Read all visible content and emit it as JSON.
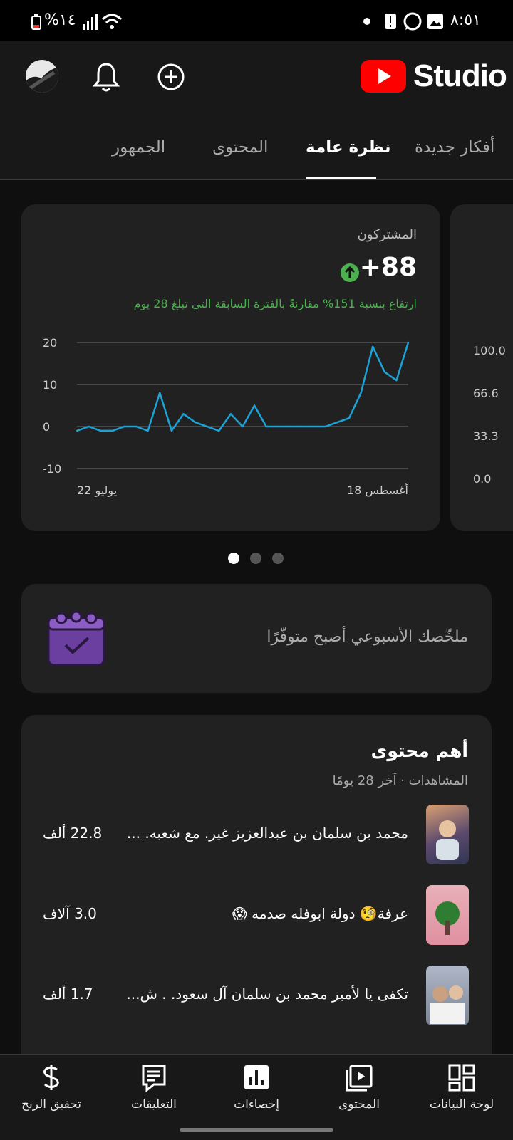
{
  "status_bar": {
    "time": "٨:٥١",
    "battery": "%١٤"
  },
  "header": {
    "brand": "Studio"
  },
  "tabs": [
    {
      "label": "أفكار جديدة"
    },
    {
      "label": "نظرة عامة"
    },
    {
      "label": "المحتوى"
    },
    {
      "label": "الجمهور"
    }
  ],
  "subscribers_card": {
    "title": "المشتركون",
    "value": "+88",
    "change_text": "ارتفاع بنسبة 151% مقارنةً بالفترة السابقة التي تبلغ 28 يوم",
    "accent_color": "#4caf50",
    "line_color": "#1aa3d8"
  },
  "chart_data": [
    {
      "type": "line",
      "title": "المشتركون",
      "xlabel": "",
      "ylabel": "",
      "x_tick_labels": [
        "22 يوليو",
        "18 أغسطس"
      ],
      "y_ticks": [
        20,
        10,
        0,
        -10
      ],
      "ylim": [
        -10,
        20
      ],
      "grid": true,
      "series": [
        {
          "values": [
            -1,
            0,
            -1,
            -1,
            0,
            0,
            -1,
            8,
            -1,
            3,
            1,
            0,
            -1,
            3,
            0,
            5,
            0,
            0,
            0,
            0,
            0,
            0,
            1,
            2,
            8,
            19,
            13,
            11,
            20
          ]
        }
      ]
    }
  ],
  "peek_card": {
    "y_ticks": [
      "100.0",
      "66.6",
      "33.3",
      "0.0"
    ]
  },
  "pager": {
    "active_index": 0,
    "count": 3
  },
  "weekly_summary": {
    "text": "ملخّصك الأسبوعي أصبح متوفّرًا"
  },
  "top_content": {
    "title": "أهم محتوى",
    "subtitle": "المشاهدات · آخر 28 يومًا",
    "items": [
      {
        "title": "محمد بن سلمان بن عبدالعزيز  غير. مع شعبه. ...",
        "views": "22.8 ألف"
      },
      {
        "title": "عرفة🧐 دولة ابوفله صدمه 😱",
        "views": "3.0 آلاف"
      },
      {
        "title": "تكفى يا لأمير  محمد بن سلمان آل سعود.  .  ش...",
        "views": "1.7 ألف"
      }
    ]
  },
  "bottom_nav": [
    {
      "label": "تحقيق الربح",
      "icon": "dollar-icon"
    },
    {
      "label": "التعليقات",
      "icon": "comments-icon"
    },
    {
      "label": "إحصاءات",
      "icon": "analytics-icon"
    },
    {
      "label": "المحتوى",
      "icon": "content-icon"
    },
    {
      "label": "لوحة البيانات",
      "icon": "dashboard-icon"
    }
  ]
}
